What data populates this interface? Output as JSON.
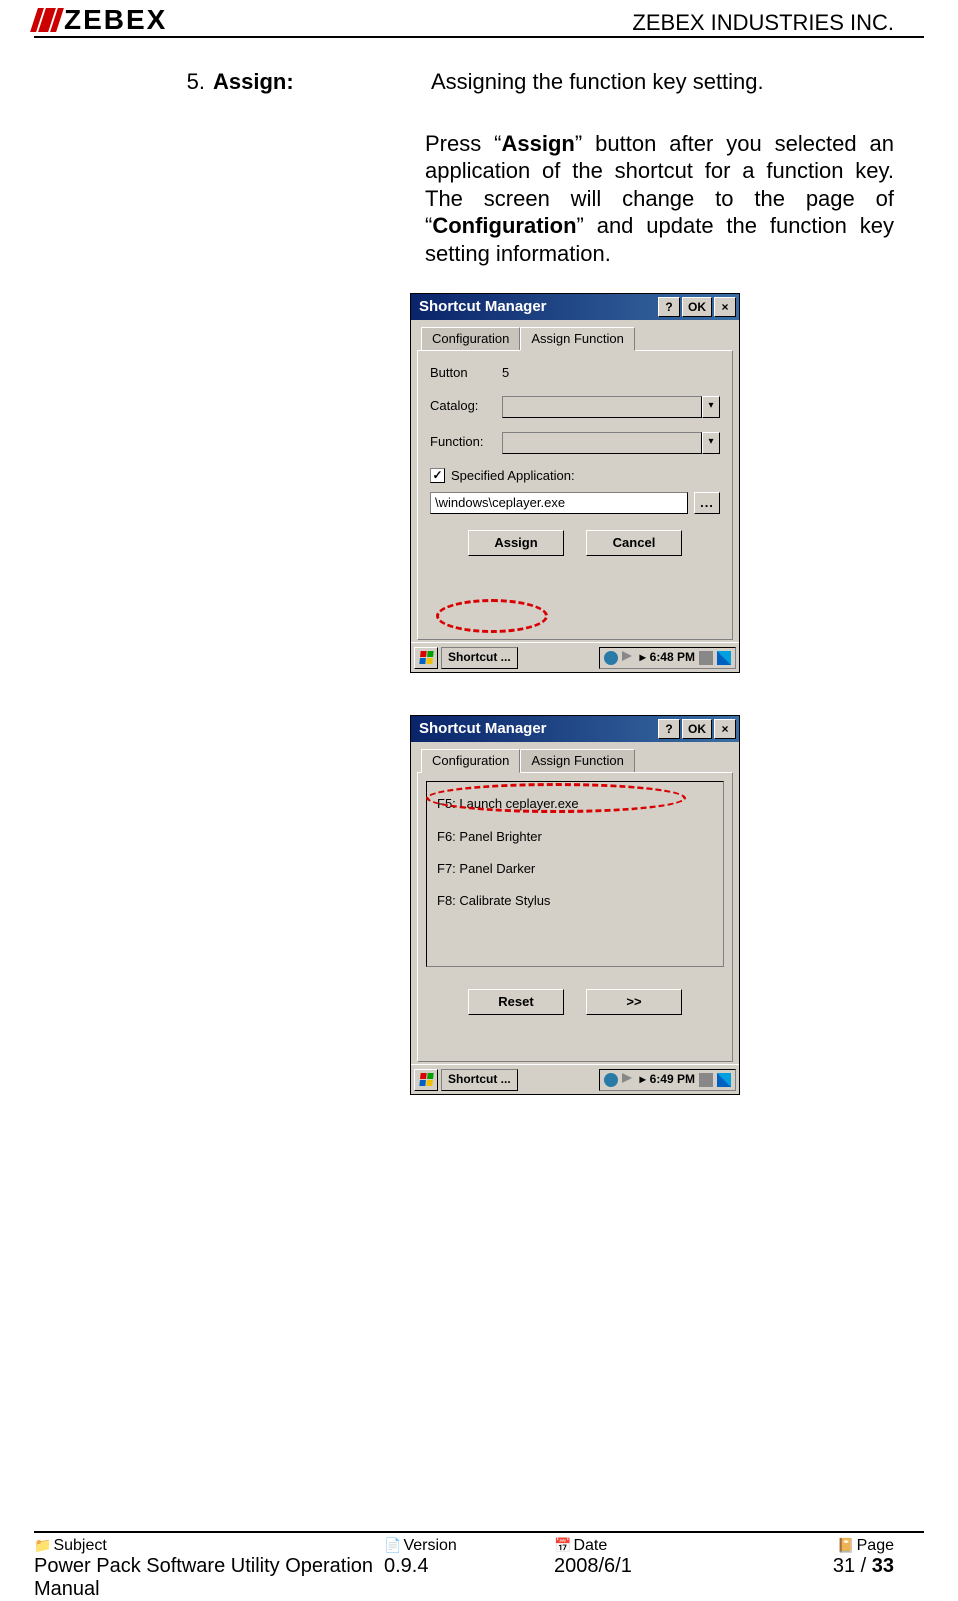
{
  "header": {
    "logo_text": "ZEBEX",
    "company": "ZEBEX INDUSTRIES INC."
  },
  "section": {
    "number": "5.",
    "label": "Assign:",
    "intro": "Assigning the function key setting.",
    "para": "Press “Assign” button after you selected an application of the shortcut for a function key. The screen will change to the page of “Configuration” and update the function key setting information.",
    "bold1": "Assign",
    "bold2": "Configuration"
  },
  "shot1": {
    "title": "Shortcut Manager",
    "help": "?",
    "ok": "OK",
    "close": "×",
    "tab_config": "Configuration",
    "tab_assign": "Assign Function",
    "button_lbl": "Button",
    "button_val": "5",
    "catalog_lbl": "Catalog:",
    "function_lbl": "Function:",
    "chk_lbl": "Specified Application:",
    "path": "\\windows\\ceplayer.exe",
    "browse": "...",
    "assign_btn": "Assign",
    "cancel_btn": "Cancel",
    "task_btn": "Shortcut ...",
    "tray_arrow": "▸",
    "time": "6:48 PM"
  },
  "shot2": {
    "title": "Shortcut Manager",
    "help": "?",
    "ok": "OK",
    "close": "×",
    "tab_config": "Configuration",
    "tab_assign": "Assign Function",
    "items": {
      "f5": "F5:  Launch ceplayer.exe",
      "f6": "F6:  Panel Brighter",
      "f7": "F7:  Panel Darker",
      "f8": "F8:  Calibrate Stylus"
    },
    "reset_btn": "Reset",
    "next_btn": ">>",
    "task_btn": "Shortcut ...",
    "tray_arrow": "▸",
    "time": "6:49 PM"
  },
  "footer": {
    "subject_h": "Subject",
    "subject_v": "Power Pack Software Utility Operation Manual",
    "version_h": "Version",
    "version_v": "0.9.4",
    "date_h": "Date",
    "date_v": "2008/6/1",
    "page_h": "Page",
    "page_cur": "31",
    "page_sep": " / ",
    "page_tot": "33"
  }
}
